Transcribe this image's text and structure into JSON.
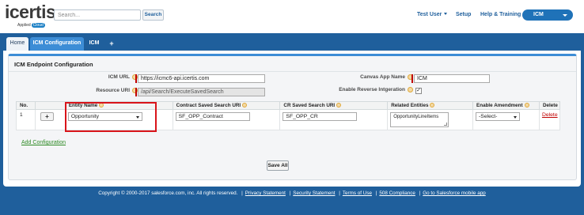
{
  "header": {
    "logo_text": "icertis",
    "logo_sub": "Applied",
    "logo_badge": "Cloud",
    "search_placeholder": "Search...",
    "search_button": "Search",
    "user_menu": "Test User",
    "setup": "Setup",
    "help": "Help & Training",
    "app_menu": "ICM"
  },
  "tabs": {
    "home": "Home",
    "active": "ICM Configuration",
    "icm": "ICM",
    "plus": "+"
  },
  "panel": {
    "title": "ICM Endpoint Configuration",
    "icm_url_label": "ICM URL",
    "icm_url_value": "https://icmc6-api.icertis.com",
    "resource_uri_label": "Resource URI",
    "resource_uri_value": "/api/Search/ExecuteSavedSearch",
    "canvas_app_label": "Canvas App Name",
    "canvas_app_value": "ICM",
    "reverse_integration_label": "Enable Reverse Intgeration",
    "reverse_integration_checked": "✓"
  },
  "table": {
    "headers": {
      "no": "No.",
      "entity": "Entity Name",
      "contract_uri": "Contract Saved Search URI",
      "cr_uri": "CR Saved Search URI",
      "related": "Related Entities",
      "amendment": "Enable Amendment",
      "delete": "Delete"
    },
    "rows": [
      {
        "no": "1",
        "add": "+",
        "entity": "Opportunity",
        "contract_uri": "SF_OPP_Contract",
        "cr_uri": "SF_OPP_CR",
        "related": "OpportunityLineItems",
        "amendment": "-Select-",
        "delete": "Delete"
      }
    ]
  },
  "actions": {
    "add_configuration": "Add Configuration",
    "save_all": "Save All"
  },
  "footer": {
    "copyright": "Copyright © 2000-2017 salesforce.com, inc. All rights reserved.",
    "links": [
      "Privacy Statement",
      "Security Statement",
      "Terms of Use",
      "508 Compliance",
      "Go to Salesforce mobile app"
    ]
  },
  "colors": {
    "brand_blue": "#1f5f9c",
    "tab_active": "#3d8dd6",
    "required": "#c00000",
    "highlight": "#d9141a",
    "link_green": "#2e8a24"
  }
}
